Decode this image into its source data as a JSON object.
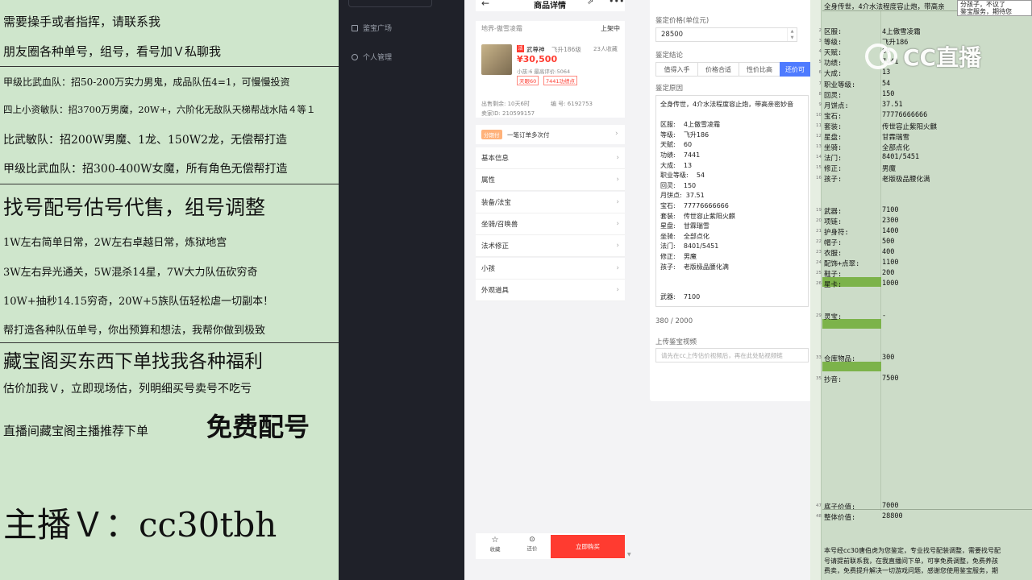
{
  "promo": {
    "lines": [
      "需要操手或者指挥，请联系我",
      "朋友圈各种单号，组号，看号加Ｖ私聊我",
      "甲级比武血队：招50-200万实力男鬼，成品队伍4=1，可慢慢投资",
      "四上小资敏队：招3700万男魔，20W+，六阶化无敌队天梯帮战水陆４等１",
      "比武敏队：招200W男魔、1龙、150W2龙，无偿帮打造",
      "甲级比武血队：招300-400W女魔，所有角色无偿帮打造",
      "找号配号估号代售，组号调整",
      "1W左右简单日常，2W左右卓越日常，炼狱地宫",
      "3W左右异光通关，5W混杀14星，7W大力队伍砍穷奇",
      "10W+抽秒14.15穷奇，20W+5族队伍轻松虐一切副本！",
      "帮打造各种队伍单号，你出预算和想法，我帮你做到极致",
      "藏宝阁买东西下单找我各种福利",
      "估价加我Ｖ，立即现场估，列明细买号卖号不吃亏",
      "直播间藏宝阁主播推荐下单",
      "免费配号",
      "主播Ｖ：cc30tbh"
    ]
  },
  "sidebar": {
    "items": [
      {
        "label": "鉴宝广场",
        "icon": "plaza-icon"
      },
      {
        "label": "个人管理",
        "icon": "user-icon"
      }
    ]
  },
  "phone": {
    "title": "商品详情",
    "server_line": "地界-傲雪凌霜",
    "status": "上架中",
    "game_badge": "活",
    "item_name": "武尊神",
    "item_level": "飞升186级",
    "favorites": "23人收藏",
    "price": "¥30,500",
    "meta": "小孩:6 最高评价:5064",
    "tag1": "天眼60",
    "tag2": "7441功绩点",
    "listed": "出售剩余: 10天6时",
    "id_label": "编 号: 6192753",
    "seller": "卖家ID: 210599157",
    "promo_badge": "分期付",
    "promo_text": "一笔订单多次付",
    "menu": [
      "基本信息",
      "属性",
      "装备/法宝",
      "坐骑/召唤兽",
      "法术修正",
      "小孩",
      "外观道具"
    ],
    "bottom": {
      "fav": "收藏",
      "bargain": "还价",
      "buy": "立即购买"
    }
  },
  "form": {
    "price_label": "鉴定价格(单位元)",
    "price_value": "28500",
    "conclusion_label": "鉴定结论",
    "tabs": [
      "值得入手",
      "价格合适",
      "性价比高",
      "还价可"
    ],
    "reason_label": "鉴定原因",
    "reason_lines": [
      "全身传世，4介水法程度容止炮，带高亲密妙音",
      "",
      "区服:    4上傲雪凌霜",
      "等级:    飞升186",
      "天赋:    60",
      "功绩:    7441",
      "大成:    13",
      "职业等级:    54",
      "回灵:    150",
      "月饼点:  37.51",
      "宝石:    77776666666",
      "套装:    传世容止紫阳火麒",
      "星盘:    甘霖瑞雪",
      "坐骑:    全部点化",
      "法门:    8401/5451",
      "修正:    男魔",
      "孩子:    老版极品腰化满",
      "",
      "",
      "武器:    7100"
    ],
    "counter": "380 / 2000",
    "video_label": "上传鉴宝视频",
    "video_placeholder": "请先在cc上传估价视频后，再在此处贴视频链"
  },
  "sheet": {
    "header": "全身传世，4介水法程度容止炮，带高亲",
    "notice_lines": [
      "分孩子，不议了",
      "鉴宝服务，期待您"
    ],
    "rows": [
      {
        "n": "2",
        "k": "区服:",
        "v": "4上傲雪凌霜"
      },
      {
        "n": "3",
        "k": "等级:",
        "v": "飞升186"
      },
      {
        "n": "4",
        "k": "天赋:",
        "v": "60"
      },
      {
        "n": "5",
        "k": "功绩:",
        "v": "7441"
      },
      {
        "n": "6",
        "k": "大成:",
        "v": "13"
      },
      {
        "n": "7",
        "k": "职业等级:",
        "v": "54"
      },
      {
        "n": "8",
        "k": "回灵:",
        "v": "150"
      },
      {
        "n": "9",
        "k": "月饼点:",
        "v": "37.51"
      },
      {
        "n": "10",
        "k": "宝石:",
        "v": "77776666666"
      },
      {
        "n": "11",
        "k": "套装:",
        "v": "传世容止紫阳火麒"
      },
      {
        "n": "12",
        "k": "星盘:",
        "v": "甘霖瑞雪"
      },
      {
        "n": "13",
        "k": "坐骑:",
        "v": "全部点化"
      },
      {
        "n": "14",
        "k": "法门:",
        "v": "8401/5451"
      },
      {
        "n": "15",
        "k": "修正:",
        "v": "男魔"
      },
      {
        "n": "16",
        "k": "孩子:",
        "v": "老版极品腰化满"
      },
      {
        "n": "19",
        "k": "武器:",
        "v": "7100"
      },
      {
        "n": "20",
        "k": "项链:",
        "v": "2300"
      },
      {
        "n": "21",
        "k": "护身符:",
        "v": "1400"
      },
      {
        "n": "22",
        "k": "帽子:",
        "v": "500"
      },
      {
        "n": "23",
        "k": "衣服:",
        "v": "400"
      },
      {
        "n": "24",
        "k": "配饰+点翠:",
        "v": "1100"
      },
      {
        "n": "25",
        "k": "鞋子:",
        "v": "200"
      },
      {
        "n": "26",
        "k": "星卡:",
        "v": "1000"
      },
      {
        "n": "29",
        "k": "灵宝:",
        "v": "-"
      },
      {
        "n": "33",
        "k": "仓库物品:",
        "v": "300"
      },
      {
        "n": "35",
        "k": "抄音:",
        "v": "7500"
      },
      {
        "n": "47",
        "k": "底子价值:",
        "v": "7000"
      },
      {
        "n": "48",
        "k": "整体价值:",
        "v": "28800"
      }
    ],
    "footer_lines": [
      "本号经cc30唐伯虎为您鉴定，专业找号配装调整，需要找号配",
      "号请提前联系我，在我直播间下单，可享免费调整，免费养孩",
      "费卖，免费提升解决一切游戏问题，感谢您使用鉴宝服务，期"
    ]
  },
  "watermark": "CC直播",
  "colors": {
    "accent": "#ff3b30",
    "blue": "#4e7bff",
    "sheet_hl": "#7cb34a",
    "sidebar": "#1f2129"
  }
}
